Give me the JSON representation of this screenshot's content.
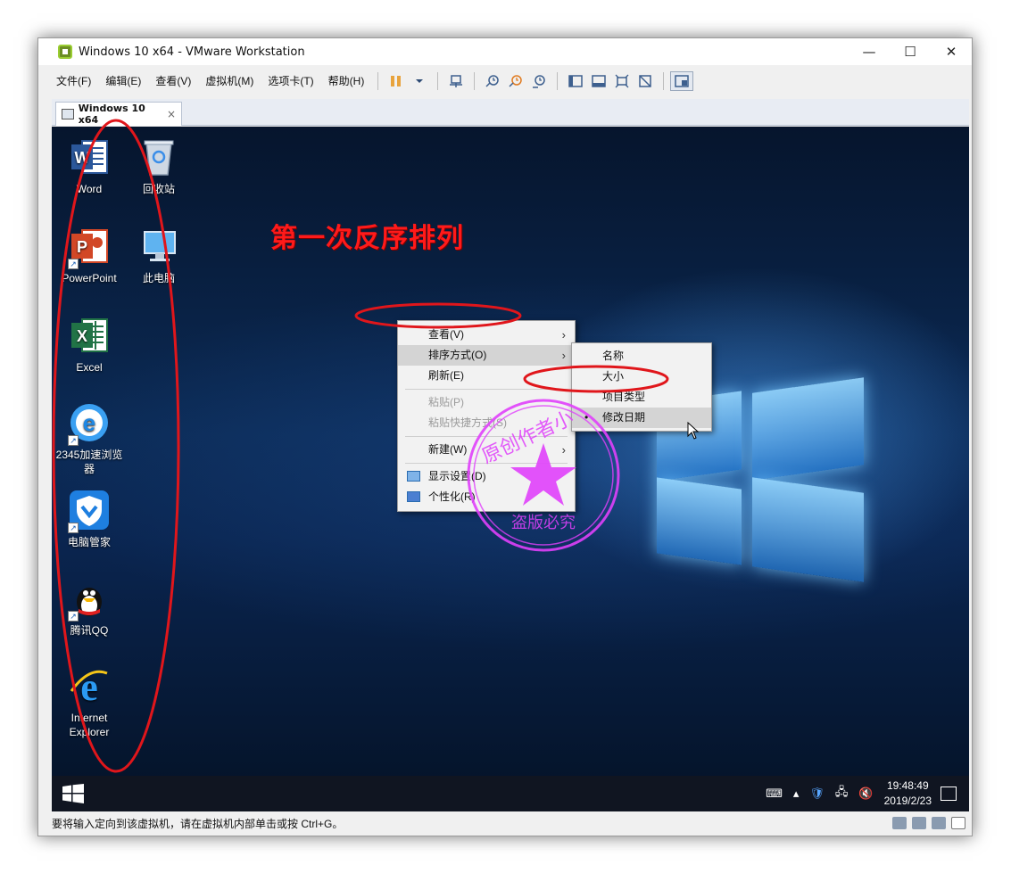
{
  "window": {
    "title": "Windows 10 x64 - VMware Workstation"
  },
  "window_controls": {
    "minimize": "—",
    "maximize": "☐",
    "close": "✕"
  },
  "menubar": {
    "items": [
      "文件(F)",
      "编辑(E)",
      "查看(V)",
      "虚拟机(M)",
      "选项卡(T)",
      "帮助(H)"
    ]
  },
  "tab": {
    "label": "Windows 10 x64",
    "close": "×"
  },
  "desktop": {
    "annotation_title": "第一次反序排列",
    "icons": [
      {
        "label": "Word",
        "icon": "word-icon"
      },
      {
        "label": "回收站",
        "icon": "recycle-bin-icon"
      },
      {
        "label": "PowerPoint",
        "icon": "powerpoint-icon"
      },
      {
        "label": "此电脑",
        "icon": "this-pc-icon"
      },
      {
        "label": "Excel",
        "icon": "excel-icon"
      },
      {
        "label": "2345加速浏览器",
        "icon": "browser-2345-icon"
      },
      {
        "label": "电脑管家",
        "icon": "pc-manager-icon"
      },
      {
        "label": "腾讯QQ",
        "icon": "qq-icon"
      },
      {
        "label": "Internet Explorer",
        "icon": "ie-icon"
      }
    ]
  },
  "context_menu": {
    "view": "查看(V)",
    "sort_by": "排序方式(O)",
    "refresh": "刷新(E)",
    "paste": "粘贴(P)",
    "paste_shortcut": "粘贴快捷方式(S)",
    "new": "新建(W)",
    "display_settings": "显示设置(D)",
    "personalize": "个性化(R)"
  },
  "submenu": {
    "name": "名称",
    "size": "大小",
    "item_type": "项目类型",
    "date_modified": "修改日期",
    "selected_bullet": "•"
  },
  "watermark": {
    "top_text": "原创作者小",
    "bottom_text": "盗版必究"
  },
  "taskbar": {
    "time": "19:48:49",
    "date": "2019/2/23"
  },
  "statusbar": {
    "message": "要将输入定向到该虚拟机，请在虚拟机内部单击或按 Ctrl+G。"
  },
  "colors": {
    "annotation_red": "#e0161b",
    "watermark_pink": "#e040fb",
    "desktop_blue": "#0b2a55"
  }
}
